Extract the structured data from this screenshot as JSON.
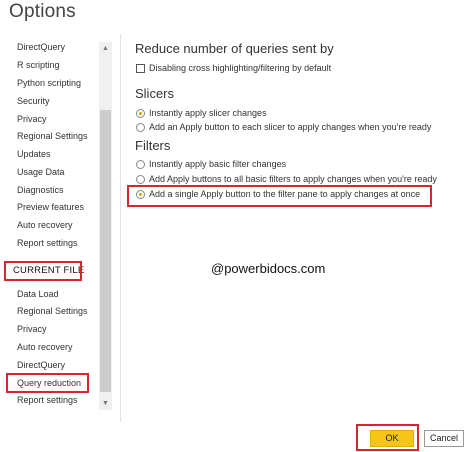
{
  "window": {
    "title": "Options"
  },
  "sidebar": {
    "global_items": [
      "DirectQuery",
      "R scripting",
      "Python scripting",
      "Security",
      "Privacy",
      "Regional Settings",
      "Updates",
      "Usage Data",
      "Diagnostics",
      "Preview features",
      "Auto recovery",
      "Report settings"
    ],
    "current_file_heading": "CURRENT FILE",
    "file_items": [
      "Data Load",
      "Regional Settings",
      "Privacy",
      "Auto recovery",
      "DirectQuery",
      "Query reduction",
      "Report settings"
    ],
    "selected": "Query reduction"
  },
  "main": {
    "reduce_title": "Reduce number of queries sent by",
    "disable_cross_highlight": {
      "label": "Disabling cross highlighting/filtering by default",
      "checked": false
    },
    "slicers": {
      "title": "Slicers",
      "options": [
        {
          "label": "Instantly apply slicer changes",
          "selected": true
        },
        {
          "label": "Add an Apply button to each slicer to apply changes when you're ready",
          "selected": false
        }
      ]
    },
    "filters": {
      "title": "Filters",
      "options": [
        {
          "label": "Instantly apply basic filter changes",
          "selected": false
        },
        {
          "label": "Add Apply buttons to all basic filters to apply changes when you're ready",
          "selected": false
        },
        {
          "label": "Add a single Apply button to the filter pane to apply changes at once",
          "selected": true
        }
      ]
    },
    "watermark": "@powerbidocs.com"
  },
  "footer": {
    "ok_label": "OK",
    "cancel_label": "Cancel"
  },
  "colors": {
    "highlight": "#d7262f",
    "ok_button": "#f5c518",
    "radio_selected": "#d6a600"
  }
}
